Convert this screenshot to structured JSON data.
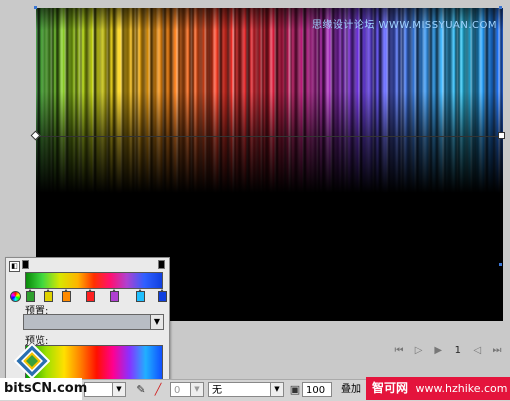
{
  "canvas": {
    "watermark": "思缘设计论坛 WWW.MISSYUAN.COM",
    "gradient_colors": [
      "#2aa52a",
      "#b7e000",
      "#ffd000",
      "#ff8a00",
      "#ff2a1a",
      "#e0102a",
      "#b0109a",
      "#6a30ff",
      "#3090ff",
      "#20d0ff",
      "#1060ff"
    ]
  },
  "navigation": {
    "first": "⏮",
    "prev": "▷",
    "play": "▶",
    "page": "1",
    "next": "◁",
    "last": "⏭"
  },
  "gradient_panel": {
    "preset_label": "预置:",
    "preview_label": "预览:",
    "preset_value": "",
    "stops": [
      {
        "color": "#2ea02e"
      },
      {
        "color": "#e0d200"
      },
      {
        "color": "#ff8a00"
      },
      {
        "color": "#ff2020"
      },
      {
        "color": "#b040d0"
      },
      {
        "color": "#20c0ff"
      },
      {
        "color": "#1040e0"
      }
    ]
  },
  "toolbar": {
    "blend_value": "",
    "stroke_size_value": "0",
    "style_value": "无",
    "opacity_value": "100",
    "blend_mode": "叠加"
  },
  "branding": {
    "bits_logo": "bitsCN.com",
    "banner_title": "智可网",
    "banner_url": "www.hzhike.com"
  }
}
